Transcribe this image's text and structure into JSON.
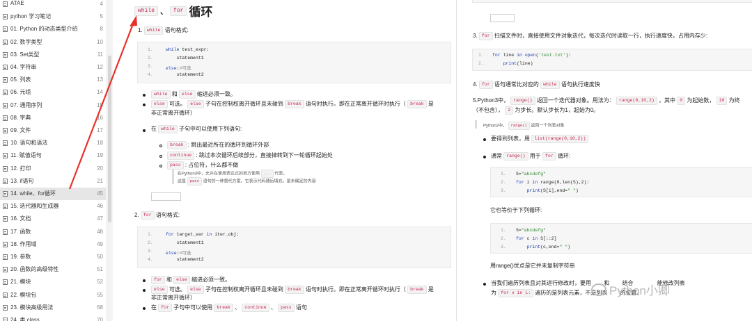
{
  "sidebar": {
    "items": [
      {
        "label": "ATAE",
        "num": "4"
      },
      {
        "label": "python 学习笔记",
        "num": "5"
      },
      {
        "label": "01. Python 的动态类型介绍",
        "num": "8"
      },
      {
        "label": "02. 数字类型",
        "num": "10"
      },
      {
        "label": "03. Set类型",
        "num": "11"
      },
      {
        "label": "04. 字符串",
        "num": "12"
      },
      {
        "label": "05. 列表",
        "num": "13"
      },
      {
        "label": "06. 元组",
        "num": "14"
      },
      {
        "label": "07. 通用序列",
        "num": "15"
      },
      {
        "label": "08. 字典",
        "num": "16"
      },
      {
        "label": "09. 文件",
        "num": "17"
      },
      {
        "label": "10. 语句和语法",
        "num": "18"
      },
      {
        "label": "11. 赋值语句",
        "num": "19"
      },
      {
        "label": "12. 打印",
        "num": "20"
      },
      {
        "label": "13. if语句",
        "num": "21"
      },
      {
        "label": "14. while、for循环",
        "num": "45"
      },
      {
        "label": "15. 迭代器和生成器",
        "num": "46"
      },
      {
        "label": "16. 文档",
        "num": "47"
      },
      {
        "label": "17. 函数",
        "num": "48"
      },
      {
        "label": "18. 作用域",
        "num": "49"
      },
      {
        "label": "19. 参数",
        "num": "50"
      },
      {
        "label": "20. 函数的高级特性",
        "num": "51"
      },
      {
        "label": "21. 模块",
        "num": "52"
      },
      {
        "label": "22. 模块包",
        "num": "55"
      },
      {
        "label": "23. 模块高级用法",
        "num": "68"
      },
      {
        "label": "24. 类 class",
        "num": "70"
      }
    ],
    "active_index": 15
  },
  "left": {
    "title": {
      "tag1": "while",
      "sep": "、",
      "tag2": "for",
      "text": "循环"
    },
    "s1": {
      "num": "1.",
      "tag": "while",
      "text": "语句格式:"
    },
    "code1": [
      {
        "n": "1.",
        "code": "while test_expr:"
      },
      {
        "n": "2.",
        "code": "    statement1"
      },
      {
        "n": "3.",
        "code": "else:#可选"
      },
      {
        "n": "4.",
        "code": "    statement2"
      }
    ],
    "b1": {
      "t1": "while",
      "w1": "和",
      "t2": "else",
      "w2": "缩进必须一致。"
    },
    "b2": {
      "t1": "else",
      "w1": "可选。",
      "t2": "else",
      "w2": "子句在控制权离开循环且未碰到",
      "t3": "break",
      "w3": "语句时执行。即在正常离开循环时执行（",
      "t4": "break",
      "w4": "是",
      "w5": "非正常离开循环）"
    },
    "b3": {
      "w1": "在",
      "t1": "while",
      "w2": "子句中可以使用下列语句:"
    },
    "sub1": {
      "t": "break",
      "w": ": 跳出最近所在的循环到循环外部"
    },
    "sub2": {
      "t": "continue",
      "w": ": 跳过本次循环后续部分，直接掉转到下一轮循环起始处"
    },
    "sub3": {
      "t": "pass",
      "w": ": 占位符，什么都不做"
    },
    "note1": {
      "w1": "在Python3中，允许在使用表达式的地方使用",
      "t": "...",
      "w2": "代表。"
    },
    "note2": {
      "w1": "这是",
      "t": "pass",
      "w2": "语句的一种替代方案，它表示代码随后填充，是未确定的内容"
    },
    "s2": {
      "num": "2.",
      "tag": "for",
      "text": "语句格式:"
    },
    "code2": [
      {
        "n": "1.",
        "code": "for target_var in iter_obj:"
      },
      {
        "n": "2.",
        "code": "    statement1"
      },
      {
        "n": "3.",
        "code": "else:#可选"
      },
      {
        "n": "4.",
        "code": "    statement2"
      }
    ],
    "c1": {
      "t1": "for",
      "w1": "和",
      "t2": "else",
      "w2": "缩进必须一致。"
    },
    "c2": {
      "t1": "else",
      "w1": "可选。",
      "t2": "else",
      "w2": "子句在控制权离开循环且未碰到",
      "t3": "break",
      "w3": "语句时执行。即在正常离开循环时执行（",
      "t4": "break",
      "w4": "是",
      "w5": "非正常离开循环）"
    },
    "c3": {
      "w1": "在",
      "t1": "for",
      "w2": "子句中可以使用",
      "t2": "break",
      "w3": "、",
      "t3": "continue",
      "w4": "、",
      "t4": "pass",
      "w5": "语句"
    }
  },
  "right": {
    "p3": {
      "num": "3.",
      "tag": "for",
      "text": "扫描文件时，直接使用文件对象迭代，每次迭代时读取一行，执行速度快，占用内存少:"
    },
    "code3": [
      {
        "n": "1.",
        "code": "for line in open('test.txt'):"
      },
      {
        "n": "2.",
        "code": "    print(line)"
      }
    ],
    "p4": {
      "num": "4.",
      "tag": "for",
      "w1": "语句通常比对应的",
      "tag2": "while",
      "w2": "语句执行速度快"
    },
    "p5": {
      "w1": "5.Python3中，",
      "t1": "range()",
      "w2": "返回一个迭代器对象。用法为：",
      "t2": "range(0,10,2)",
      "w3": "，其中",
      "t3": "0",
      "w4": "为起始数，",
      "t4": "10",
      "w5": "为终",
      "w6": "（不包含），",
      "t5": "2",
      "w7": "为步长。默认步长为1，起始为0。"
    },
    "q": {
      "w1": "Python2中，",
      "t": "range()",
      "w2": "返回一个列表对象"
    },
    "r1": {
      "w": "要得到列表，用",
      "t": "list(range(0,10,2))"
    },
    "r2": {
      "w1": "通常",
      "t1": "range()",
      "w2": "用于",
      "t2": "for",
      "w3": "循环:"
    },
    "code4": [
      {
        "n": "1.",
        "code": "S=\"abcdefg\""
      },
      {
        "n": "2.",
        "code": "for i in range(0,len(S),2):"
      },
      {
        "n": "3.",
        "code": "    print(S[i],end=\" \")"
      }
    ],
    "eq": "它也等价于下列循环:",
    "code5": [
      {
        "n": "1.",
        "code": "S=\"abcdefg\""
      },
      {
        "n": "2.",
        "code": "for c in S[::2]"
      },
      {
        "n": "3.",
        "code": "    print(c,end=\" \")"
      }
    ],
    "adv": "用range()优点是它并未复制字符串",
    "last1": {
      "w1": "当我们遍历列表且对其进行修改时，要用",
      "w2": "和",
      "w3": "结合",
      "w4": "能修改列表"
    },
    "last2": {
      "w1": "为",
      "t": "for x in L:",
      "w2": "遍历的是列表元素，不是列表",
      "w3": "的位置。"
    },
    "watermark": "Python小卿"
  },
  "colors": {
    "accent_arrow": "#e8312a",
    "tag_text": "#c7254e",
    "keyword": "#1d3db0"
  }
}
